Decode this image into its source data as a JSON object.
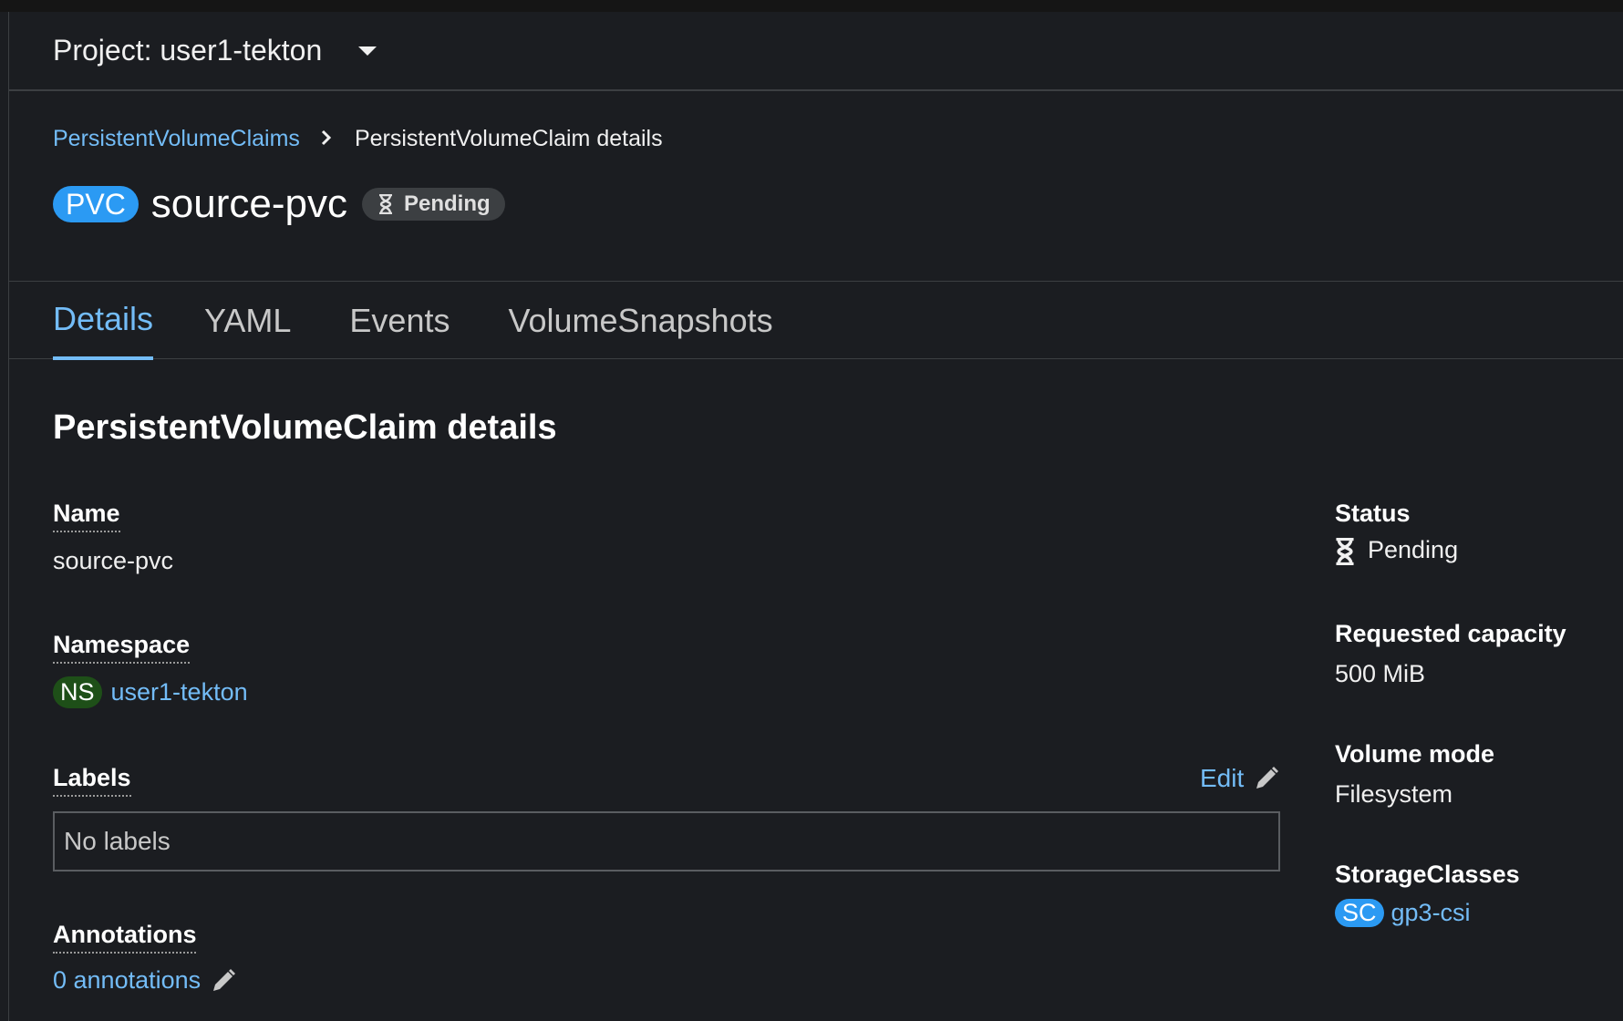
{
  "project": {
    "label": "Project: user1-tekton"
  },
  "breadcrumb": {
    "parent": "PersistentVolumeClaims",
    "current": "PersistentVolumeClaim details"
  },
  "header": {
    "kind_badge": "PVC",
    "name": "source-pvc",
    "status": "Pending"
  },
  "tabs": [
    {
      "label": "Details",
      "active": true
    },
    {
      "label": "YAML"
    },
    {
      "label": "Events"
    },
    {
      "label": "VolumeSnapshots"
    }
  ],
  "details": {
    "section_title": "PersistentVolumeClaim details",
    "name_label": "Name",
    "name_value": "source-pvc",
    "namespace_label": "Namespace",
    "namespace_badge": "NS",
    "namespace_value": "user1-tekton",
    "labels_label": "Labels",
    "labels_edit": "Edit",
    "labels_empty": "No labels",
    "annotations_label": "Annotations",
    "annotations_value": "0 annotations"
  },
  "side": {
    "status_label": "Status",
    "status_value": "Pending",
    "capacity_label": "Requested capacity",
    "capacity_value": "500 MiB",
    "volume_mode_label": "Volume mode",
    "volume_mode_value": "Filesystem",
    "storage_classes_label": "StorageClasses",
    "storage_class_badge": "SC",
    "storage_class_value": "gp3-csi"
  },
  "colors": {
    "link": "#73bcf7",
    "pvc_badge": "#2b9af3",
    "ns_badge": "#1e4f18",
    "background": "#1b1d21"
  }
}
